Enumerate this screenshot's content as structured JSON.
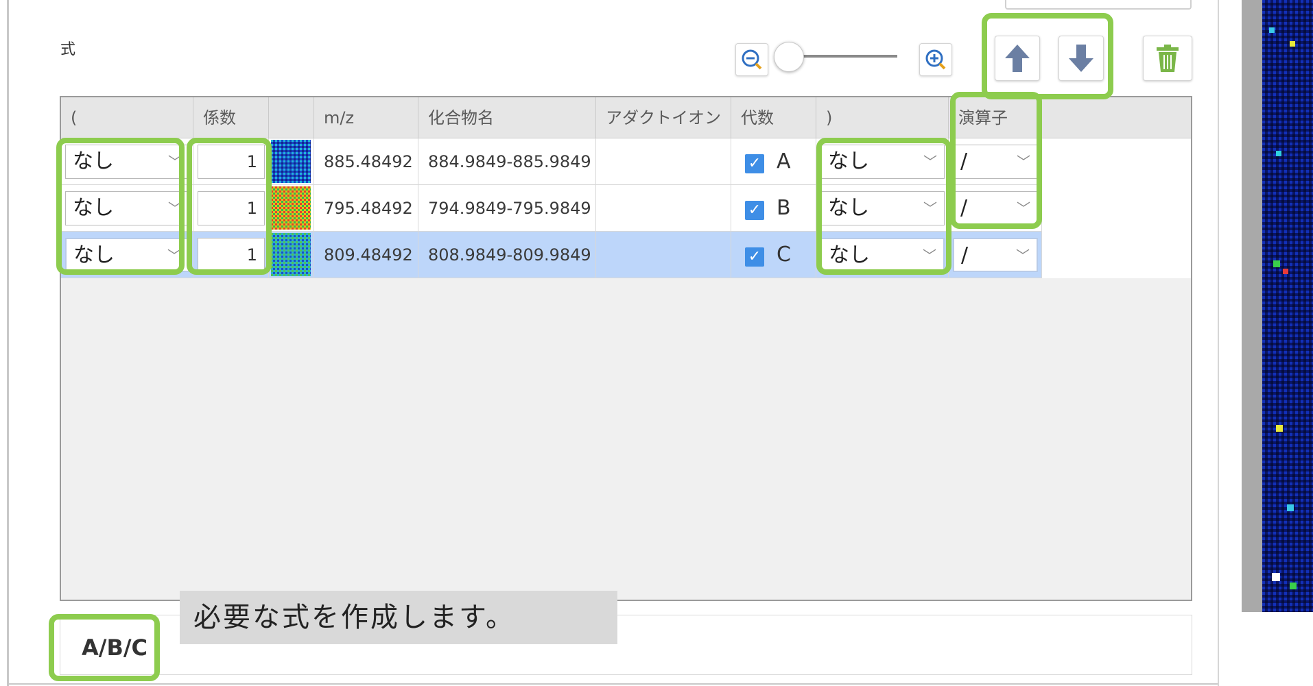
{
  "section_label": "式",
  "toolbar": {
    "zoom_out_icon": "zoom-out-icon",
    "zoom_in_icon": "zoom-in-icon",
    "move_up_icon": "arrow-up-icon",
    "move_down_icon": "arrow-down-icon",
    "delete_icon": "trash-icon"
  },
  "columns": [
    "(",
    "係数",
    "",
    "m/z",
    "化合物名",
    "アダクトイオン",
    "代数",
    ")",
    "演算子"
  ],
  "rows": [
    {
      "open_paren": "なし",
      "coef": "1",
      "mz": "885.48492",
      "compound": "884.9849-885.9849",
      "adduct": "",
      "checked": true,
      "var": "A",
      "close_paren": "なし",
      "operator": "/"
    },
    {
      "open_paren": "なし",
      "coef": "1",
      "mz": "795.48492",
      "compound": "794.9849-795.9849",
      "adduct": "",
      "checked": true,
      "var": "B",
      "close_paren": "なし",
      "operator": "/"
    },
    {
      "open_paren": "なし",
      "coef": "1",
      "mz": "809.48492",
      "compound": "808.9849-809.9849",
      "adduct": "",
      "checked": true,
      "var": "C",
      "close_paren": "なし",
      "operator": "/"
    }
  ],
  "formula": "A/B/C",
  "tooltip": "必要な式を作成します。",
  "colors": {
    "callout": "#8dcc4e",
    "selected_row": "#bdd6fa",
    "checkbox": "#3e8ee6",
    "trash": "#7ab648"
  }
}
